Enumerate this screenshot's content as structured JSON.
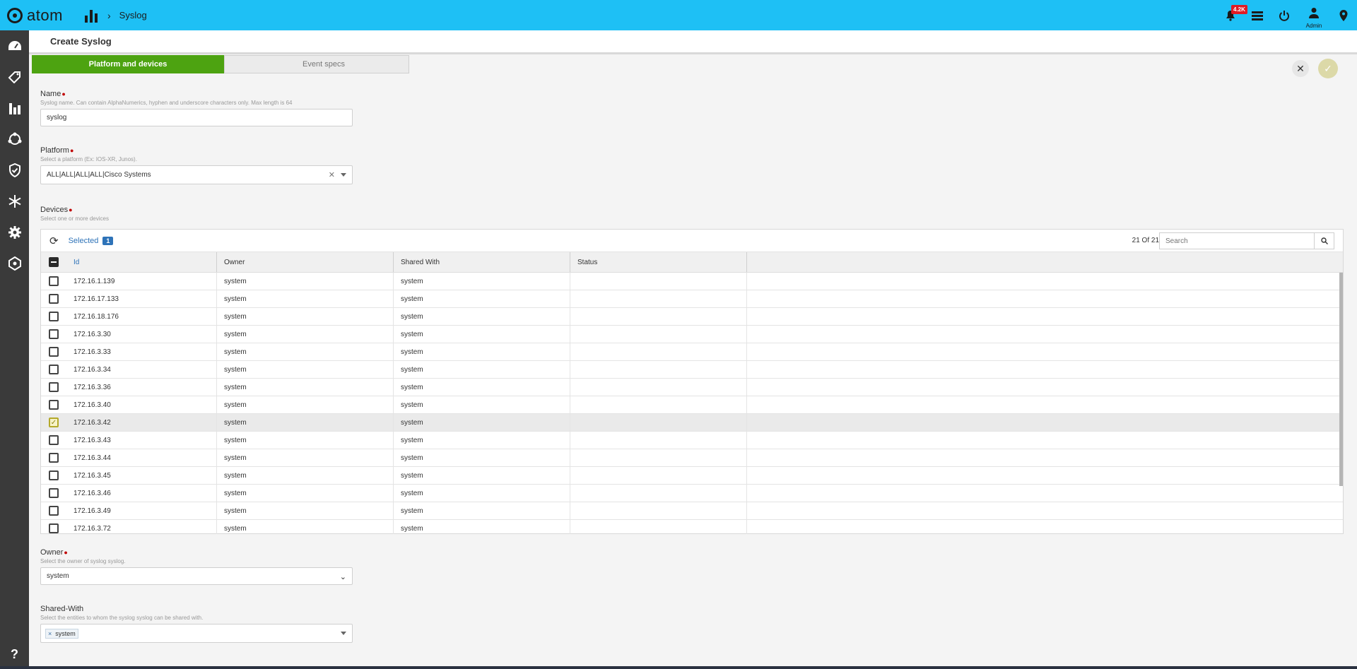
{
  "app": {
    "logo_text": "atom",
    "breadcrumb": "Syslog",
    "notification_badge": "4.2K",
    "user_label": "Admin"
  },
  "page": {
    "title": "Create Syslog"
  },
  "steps": [
    {
      "label": "Platform and devices",
      "active": true
    },
    {
      "label": "Event specs",
      "active": false
    }
  ],
  "form": {
    "name": {
      "label": "Name",
      "help": "Syslog name. Can contain AlphaNumerics, hyphen and underscore characters only. Max length is 64",
      "value": "syslog"
    },
    "platform": {
      "label": "Platform",
      "help": "Select a platform (Ex: IOS-XR, Junos).",
      "value": "ALL|ALL|ALL|ALL|Cisco Systems"
    },
    "devices": {
      "label": "Devices",
      "help": "Select one or more devices"
    },
    "owner": {
      "label": "Owner",
      "help": "Select the owner of syslog syslog.",
      "value": "system"
    },
    "shared_with": {
      "label": "Shared-With",
      "help": "Select the entities to whom the syslog syslog can be shared with.",
      "tag": "system",
      "tag_remove": "×"
    }
  },
  "table": {
    "selected_label": "Selected",
    "selected_count": "1",
    "count_text": "21 Of 21",
    "search_placeholder": "Search",
    "columns": [
      "Id",
      "Owner",
      "Shared With",
      "Status"
    ],
    "rows": [
      {
        "id": "172.16.1.139",
        "owner": "system",
        "shared": "system",
        "checked": false
      },
      {
        "id": "172.16.17.133",
        "owner": "system",
        "shared": "system",
        "checked": false
      },
      {
        "id": "172.16.18.176",
        "owner": "system",
        "shared": "system",
        "checked": false
      },
      {
        "id": "172.16.3.30",
        "owner": "system",
        "shared": "system",
        "checked": false
      },
      {
        "id": "172.16.3.33",
        "owner": "system",
        "shared": "system",
        "checked": false
      },
      {
        "id": "172.16.3.34",
        "owner": "system",
        "shared": "system",
        "checked": false
      },
      {
        "id": "172.16.3.36",
        "owner": "system",
        "shared": "system",
        "checked": false
      },
      {
        "id": "172.16.3.40",
        "owner": "system",
        "shared": "system",
        "checked": false
      },
      {
        "id": "172.16.3.42",
        "owner": "system",
        "shared": "system",
        "checked": true
      },
      {
        "id": "172.16.3.43",
        "owner": "system",
        "shared": "system",
        "checked": false
      },
      {
        "id": "172.16.3.44",
        "owner": "system",
        "shared": "system",
        "checked": false
      },
      {
        "id": "172.16.3.45",
        "owner": "system",
        "shared": "system",
        "checked": false
      },
      {
        "id": "172.16.3.46",
        "owner": "system",
        "shared": "system",
        "checked": false
      },
      {
        "id": "172.16.3.49",
        "owner": "system",
        "shared": "system",
        "checked": false
      },
      {
        "id": "172.16.3.72",
        "owner": "system",
        "shared": "system",
        "checked": false
      }
    ]
  },
  "colors": {
    "topbar": "#1ec0f5",
    "sidebar": "#3a3a3a",
    "step_active": "#4da311",
    "accent": "#2e73b8"
  }
}
